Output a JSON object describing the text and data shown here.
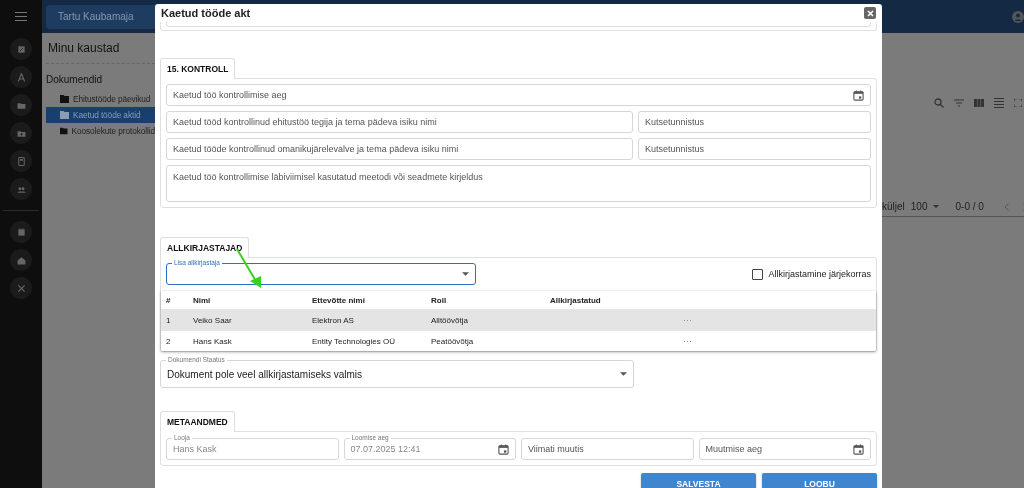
{
  "app_bar": {
    "breadcrumb": "Tartu Kaubamaja"
  },
  "folders": {
    "title": "Minu kaustad",
    "tree": [
      {
        "label": "Dokumendid",
        "children": [
          {
            "label": "Ehitustööde päevikud",
            "selected": false
          },
          {
            "label": "Kaetud tööde aktid",
            "selected": true
          },
          {
            "label": "Koosolekute protokollid",
            "selected": false
          }
        ]
      }
    ]
  },
  "list_behind": {
    "rows_label": "küljel",
    "page_size": "100",
    "range": "0-0 / 0"
  },
  "dialog": {
    "title": "Kaetud tööde akt",
    "control": {
      "tab": "15. KONTROLL",
      "rows": [
        {
          "fields": [
            {
              "placeholder": "Kaetud töö kontrollimise aeg",
              "kind": "date"
            }
          ]
        },
        {
          "fields": [
            {
              "placeholder": "Kaetud tööd kontrollinud ehitustöö tegija ja tema pädeva isiku nimi",
              "kind": "text"
            },
            {
              "placeholder": "Kutsetunnistus",
              "kind": "text"
            }
          ]
        },
        {
          "fields": [
            {
              "placeholder": "Kaetud tööde kontrollinud omanikujärelevalve ja tema pädeva isiku nimi",
              "kind": "text"
            },
            {
              "placeholder": "Kutsetunnistus",
              "kind": "text"
            }
          ]
        },
        {
          "fields": [
            {
              "placeholder": "Kaetud töö kontrollimise läbiviimisel kasutatud meetodi või seadmete kirjeldus",
              "kind": "textarea"
            }
          ]
        }
      ]
    },
    "signers": {
      "tab": "ALLKIRJASTAJAD",
      "add_field": {
        "label": "Lisa allkirjastaja",
        "focused": true
      },
      "order_checkbox": {
        "label": "Allkirjastamine järjekorras",
        "checked": false
      },
      "columns": [
        "#",
        "Nimi",
        "Ettevõtte nimi",
        "Roll",
        "Allkirjastatud"
      ],
      "rows": [
        {
          "number": "1",
          "name": "Veiko Saar",
          "company": "Elektron AS",
          "role": "Alltöövõtja",
          "menu": "···",
          "selected": true
        },
        {
          "number": "2",
          "name": "Hans Kask",
          "company": "Entity Technologies OÜ",
          "role": "Peatöövõtja",
          "menu": "···",
          "selected": false
        }
      ]
    },
    "status_field": {
      "label": "Dokumendi Staatus",
      "value": "Dokument pole veel allkirjastamiseks valmis"
    },
    "metadata": {
      "tab": "METAANDMED",
      "fields": [
        {
          "label": "Looja",
          "value": "Hans Kask",
          "kind": "text"
        },
        {
          "label": "Loomise aeg",
          "value": "07.07.2025 12:41",
          "kind": "date"
        },
        {
          "placeholder": "Viimati muutis",
          "kind": "text"
        },
        {
          "placeholder": "Muutmise aeg",
          "kind": "date"
        }
      ]
    },
    "buttons": [
      "SALVESTA",
      "LOOBU"
    ]
  }
}
